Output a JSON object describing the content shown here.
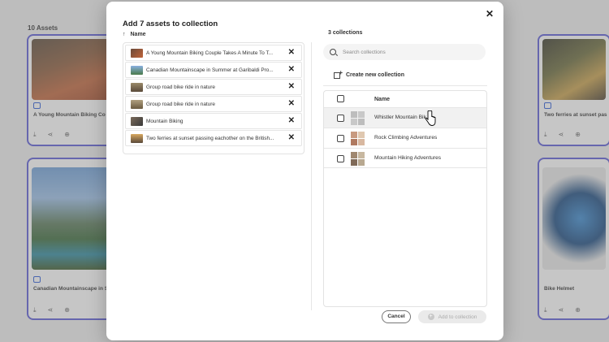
{
  "background": {
    "assets_count": "10 Assets",
    "cards": [
      {
        "title": "A Young Mountain Biking Co"
      },
      {
        "title": "Two ferries at sunset pas"
      },
      {
        "title": "Canadian Mountainscape in S"
      },
      {
        "title": "Bike Helmet"
      }
    ]
  },
  "modal": {
    "title": "Add 7 assets to collection",
    "list_header": "Name",
    "assets": [
      {
        "name": "A Young Mountain Biking Couple Takes A Minute To T..."
      },
      {
        "name": "Canadian Mountainscape in Summer at Garibaldi Pro..."
      },
      {
        "name": "Group road bike ride in nature"
      },
      {
        "name": "Group road bike ride in nature"
      },
      {
        "name": "Mountain Biking"
      },
      {
        "name": "Two ferries at sunset passing eachother on the British..."
      }
    ],
    "collections_count": "3 collections",
    "search_placeholder": "Search collections",
    "create_label": "Create new collection",
    "table_header": "Name",
    "collections": [
      {
        "name": "Whistler Mountain Bik"
      },
      {
        "name": "Rock Climbing Adventures"
      },
      {
        "name": "Mountain Hiking Adventures"
      }
    ],
    "cancel_label": "Cancel",
    "add_label": "Add to collection"
  },
  "colors": {
    "accent": "#5b5bd6",
    "selection_border": "#5b5bd6"
  }
}
